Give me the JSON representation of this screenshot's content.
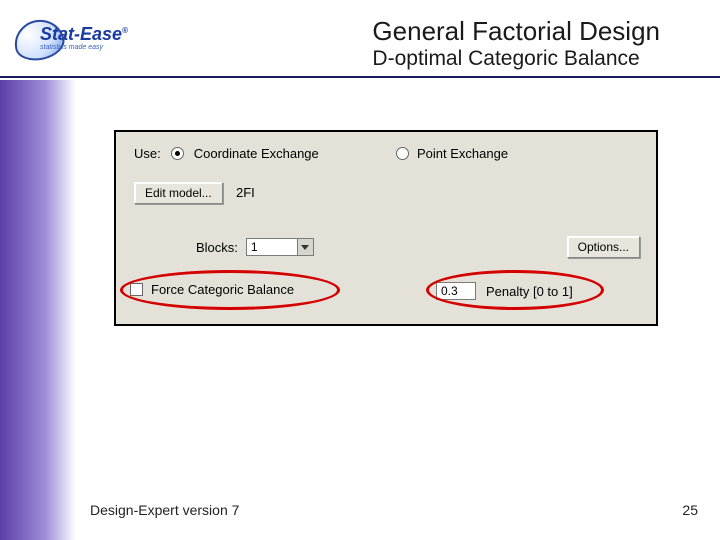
{
  "logo": {
    "brand": "Stat-Ease",
    "reg": "®",
    "tagline": "statistics made easy"
  },
  "header": {
    "title": "General Factorial Design",
    "subtitle": "D-optimal Categoric Balance"
  },
  "panel": {
    "use_label": "Use:",
    "opt_coord": "Coordinate Exchange",
    "opt_point": "Point Exchange",
    "coord_selected": true,
    "point_selected": false,
    "edit_model_btn": "Edit model...",
    "model_label": "2FI",
    "blocks_label": "Blocks:",
    "blocks_value": "1",
    "options_btn": "Options...",
    "force_balance_label": "Force Categoric Balance",
    "penalty_value": "0.3",
    "penalty_label": "Penalty [0 to 1]"
  },
  "footer": {
    "product": "Design-Expert version 7",
    "page": "25"
  }
}
